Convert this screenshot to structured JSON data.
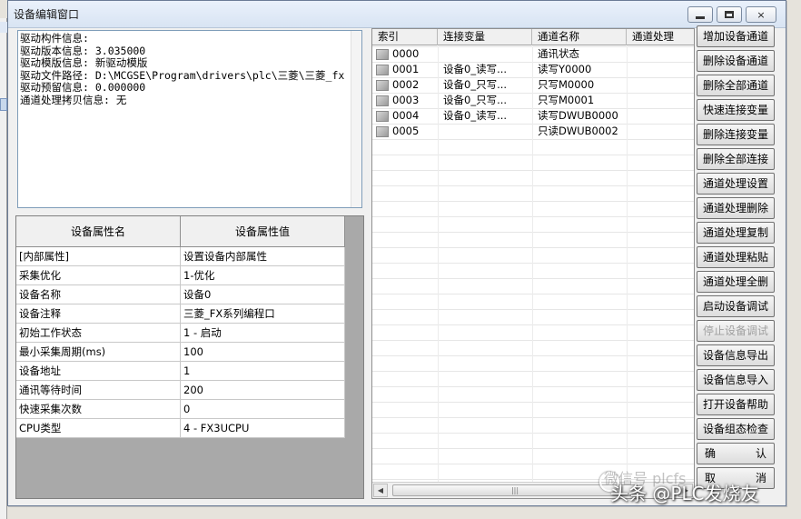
{
  "window": {
    "title": "设备编辑窗口",
    "controls": {
      "minimize": "minimize-icon",
      "maximize": "maximize-icon",
      "close": "×"
    }
  },
  "info_lines": [
    "驱动构件信息:",
    "驱动版本信息: 3.035000",
    "驱动模版信息: 新驱动模版",
    "驱动文件路径: D:\\MCGSE\\Program\\drivers\\plc\\三菱\\三菱_fx",
    "驱动预留信息: 0.000000",
    "通道处理拷贝信息: 无"
  ],
  "properties": {
    "header": {
      "name": "设备属性名",
      "value": "设备属性值"
    },
    "rows": [
      {
        "name": "[内部属性]",
        "value": "设置设备内部属性"
      },
      {
        "name": "采集优化",
        "value": "1-优化"
      },
      {
        "name": "设备名称",
        "value": "设备0"
      },
      {
        "name": "设备注释",
        "value": "三菱_FX系列编程口"
      },
      {
        "name": "初始工作状态",
        "value": "1 - 启动"
      },
      {
        "name": "最小采集周期(ms)",
        "value": "100"
      },
      {
        "name": "设备地址",
        "value": "1"
      },
      {
        "name": "通讯等待时间",
        "value": "200"
      },
      {
        "name": "快速采集次数",
        "value": "0"
      },
      {
        "name": "CPU类型",
        "value": "4 - FX3UCPU"
      }
    ]
  },
  "channels": {
    "columns": [
      "索引",
      "连接变量",
      "通道名称",
      "通道处理"
    ],
    "rows": [
      {
        "index": "0000",
        "variable": "",
        "name": "通讯状态",
        "process": ""
      },
      {
        "index": "0001",
        "variable": "设备0_读写...",
        "name": "读写Y0000",
        "process": ""
      },
      {
        "index": "0002",
        "variable": "设备0_只写...",
        "name": "只写M0000",
        "process": ""
      },
      {
        "index": "0003",
        "variable": "设备0_只写...",
        "name": "只写M0001",
        "process": ""
      },
      {
        "index": "0004",
        "variable": "设备0_读写...",
        "name": "读写DWUB0000",
        "process": ""
      },
      {
        "index": "0005",
        "variable": "",
        "name": "只读DWUB0002",
        "process": ""
      }
    ]
  },
  "buttons": [
    {
      "id": "add-channel",
      "label": "增加设备通道",
      "enabled": true
    },
    {
      "id": "delete-channel",
      "label": "删除设备通道",
      "enabled": true
    },
    {
      "id": "delete-all-channels",
      "label": "删除全部通道",
      "enabled": true
    },
    {
      "id": "quick-connect-var",
      "label": "快速连接变量",
      "enabled": true
    },
    {
      "id": "delete-connect-var",
      "label": "删除连接变量",
      "enabled": true
    },
    {
      "id": "delete-all-connections",
      "label": "删除全部连接",
      "enabled": true
    },
    {
      "id": "channel-proc-settings",
      "label": "通道处理设置",
      "enabled": true
    },
    {
      "id": "channel-proc-delete",
      "label": "通道处理删除",
      "enabled": true
    },
    {
      "id": "channel-proc-copy",
      "label": "通道处理复制",
      "enabled": true
    },
    {
      "id": "channel-proc-paste",
      "label": "通道处理粘贴",
      "enabled": true
    },
    {
      "id": "channel-proc-delete-all",
      "label": "通道处理全删",
      "enabled": true
    },
    {
      "id": "start-device-debug",
      "label": "启动设备调试",
      "enabled": true
    },
    {
      "id": "stop-device-debug",
      "label": "停止设备调试",
      "enabled": false
    },
    {
      "id": "export-device-info",
      "label": "设备信息导出",
      "enabled": true
    },
    {
      "id": "import-device-info",
      "label": "设备信息导入",
      "enabled": true
    },
    {
      "id": "open-device-help",
      "label": "打开设备帮助",
      "enabled": true
    },
    {
      "id": "check-device-config",
      "label": "设备组态检查",
      "enabled": true
    }
  ],
  "confirm": {
    "left": "确",
    "right": "认"
  },
  "cancel": {
    "left": "取",
    "right": "消"
  },
  "watermark": {
    "faint": "微信号 plcfs",
    "main": "头条 @PLC发烧友"
  },
  "colors": {
    "list_border": "#8f8f8f",
    "title_gradient_top": "#eaf1fb",
    "disabled_text": "#a0a0a0"
  }
}
